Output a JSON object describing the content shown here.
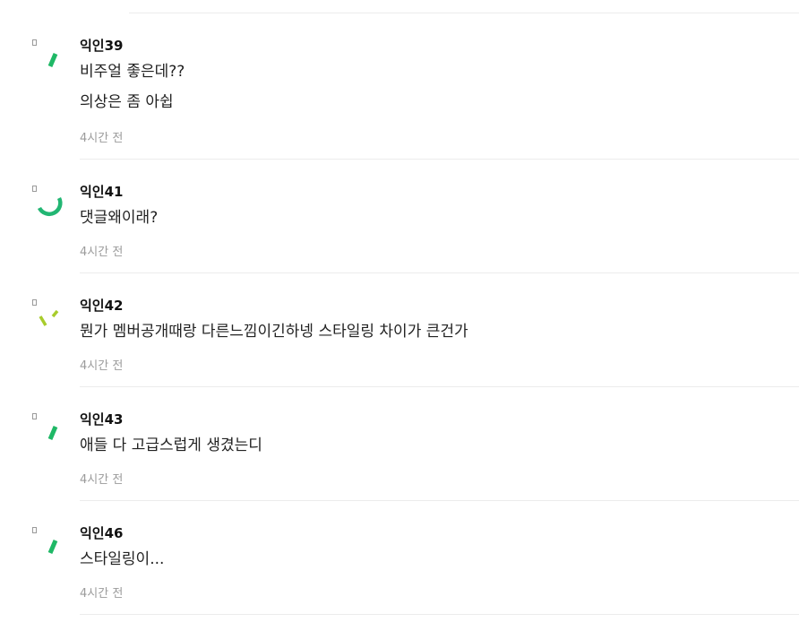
{
  "comments": [
    {
      "nickname": "익인39",
      "lines": [
        "비주얼 좋은데??",
        "의상은 좀 아쉽"
      ],
      "time": "4시간 전",
      "avatar_icon": "loading-spinner-icon",
      "avatar_color": "#1fb866"
    },
    {
      "nickname": "익인41",
      "lines": [
        "댓글왜이래?"
      ],
      "time": "4시간 전",
      "avatar_icon": "loading-spinner-icon",
      "avatar_color": "#22b673"
    },
    {
      "nickname": "익인42",
      "lines": [
        "뭔가 멤버공개때랑 다른느낌이긴하넹 스타일링 차이가 큰건가"
      ],
      "time": "4시간 전",
      "avatar_icon": "loading-spinner-icon",
      "avatar_color": "#a8cc2c"
    },
    {
      "nickname": "익인43",
      "lines": [
        "애들 다 고급스럽게 생겼는디"
      ],
      "time": "4시간 전",
      "avatar_icon": "loading-spinner-icon",
      "avatar_color": "#1fb866"
    },
    {
      "nickname": "익인46",
      "lines": [
        "스타일링이..."
      ],
      "time": "4시간 전",
      "avatar_icon": "loading-spinner-icon",
      "avatar_color": "#1fb866"
    }
  ]
}
